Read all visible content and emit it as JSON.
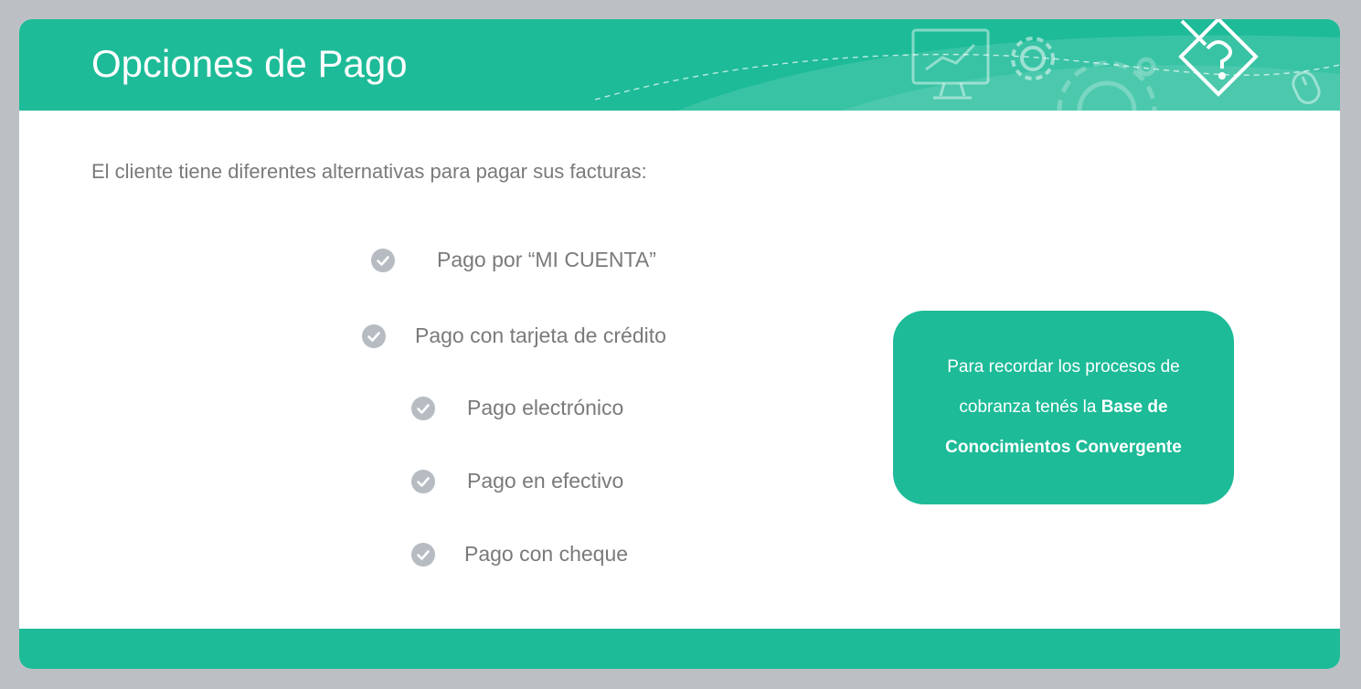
{
  "header": {
    "title": "Opciones de Pago",
    "decorations": [
      "monitor-chart-icon",
      "gear-icon",
      "pencil-question-icon",
      "mouse-icon"
    ]
  },
  "intro": "El cliente tiene diferentes alternativas para pagar sus facturas:",
  "options": [
    {
      "label": "Pago por “MI CUENTA”",
      "icon": "check-circle-icon"
    },
    {
      "label": "Pago con tarjeta de crédito",
      "icon": "check-circle-icon"
    },
    {
      "label": "Pago electrónico",
      "icon": "check-circle-icon"
    },
    {
      "label": "Pago en efectivo",
      "icon": "check-circle-icon"
    },
    {
      "label": "Pago con cheque",
      "icon": "check-circle-icon"
    }
  ],
  "callout": {
    "text_line1": "Para recordar los procesos de",
    "text_line2": "cobranza tenés la ",
    "bold_line2": "Base de",
    "bold_line3": "Conocimientos Convergente"
  },
  "colors": {
    "accent": "#1dbb98",
    "check": "#b6bcc2",
    "text": "#7a7a7a",
    "frame": "#bcc0c4"
  }
}
